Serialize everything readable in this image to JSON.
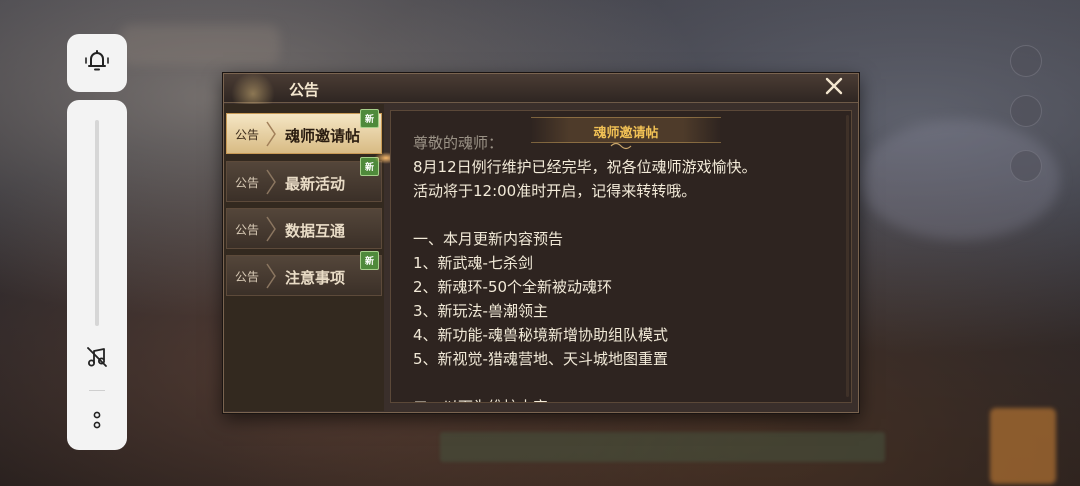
{
  "dialog": {
    "title": "公告",
    "close_icon": "close-icon"
  },
  "tabs": [
    {
      "tag": "公告",
      "label": "魂师邀请帖",
      "badge": "新",
      "active": true
    },
    {
      "tag": "公告",
      "label": "最新活动",
      "badge": "新",
      "active": false
    },
    {
      "tag": "公告",
      "label": "数据互通",
      "badge": "",
      "active": false
    },
    {
      "tag": "公告",
      "label": "注意事项",
      "badge": "新",
      "active": false
    }
  ],
  "content": {
    "title": "魂师邀请帖",
    "lines": [
      "尊敬的魂师：",
      "8月12日例行维护已经完毕，祝各位魂师游戏愉快。",
      "活动将于12:00准时开启，记得来转转哦。",
      "",
      "一、本月更新内容预告",
      "1、新武魂-七杀剑",
      "2、新魂环-50个全新被动魂环",
      "3、新玩法-兽潮领主",
      "4、新功能-魂兽秘境新增协助组队模式",
      "5、新视觉-猎魂营地、天斗城地图重置",
      "",
      "二、以下为维护内容："
    ]
  },
  "side_panel": {
    "icons": [
      "bell-icon",
      "music-off-icon",
      "more-icon"
    ]
  },
  "colors": {
    "accent_gold": "#f1c155",
    "panel_bg": "#3a2f2b",
    "badge_green": "#4f8a3b"
  }
}
